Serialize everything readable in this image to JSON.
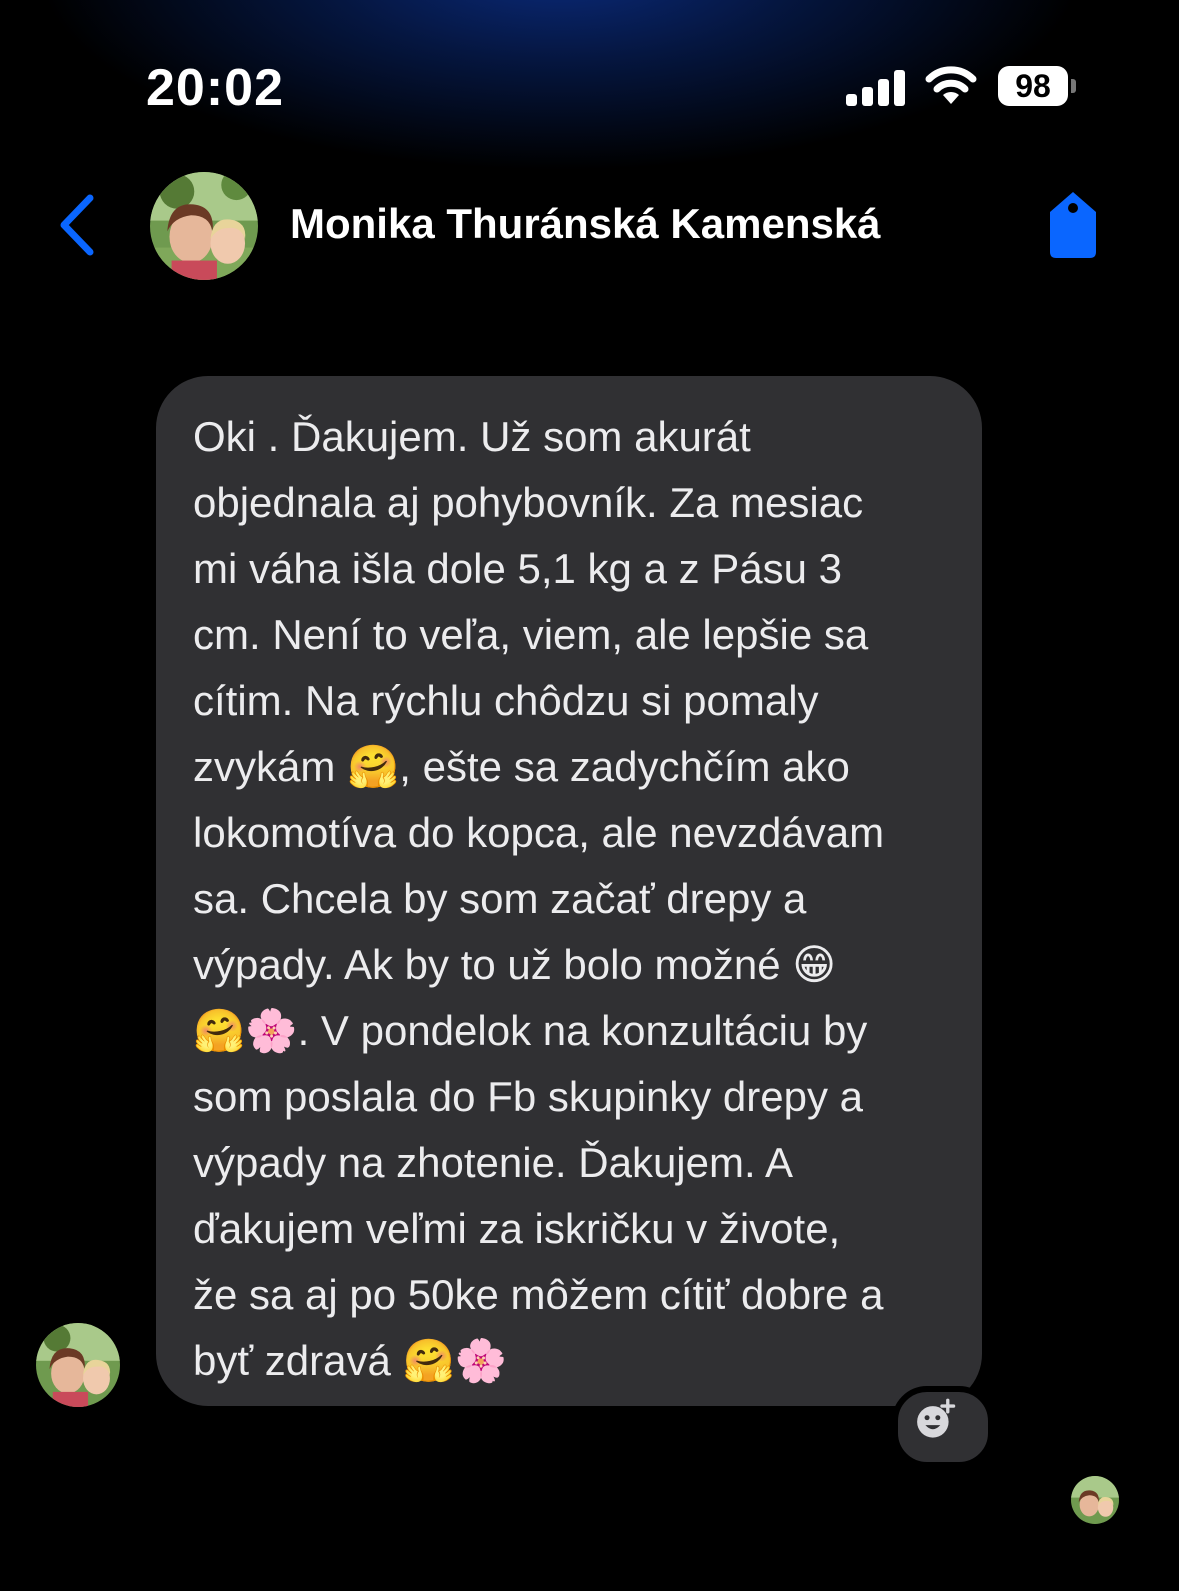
{
  "status_bar": {
    "time": "20:02",
    "battery": "98",
    "signal_icon": "cellular-signal-icon",
    "wifi_icon": "wifi-icon"
  },
  "header": {
    "back_icon": "chevron-left-icon",
    "contact_name": "Monika Thuránská Kamenská",
    "avatar_icon": "contact-avatar",
    "tag_icon": "tag-icon"
  },
  "conversation": {
    "message": "Oki . Ďakujem. Už som akurát\nobjednala aj pohybovník. Za mesiac\nmi váha išla dole 5,1 kg a z Pásu 3\ncm. Není to veľa, viem, ale lepšie sa\ncítim. Na rýchlu chôdzu si pomaly\nzvykám 🤗, ešte sa zadychčím ako\nlokomotíva do kopca, ale nevzdávam\nsa. Chcela by som začať   drepy a\nvýpady. Ak by to už bolo možné 😁\n🤗🌸. V pondelok na konzultáciu by\nsom poslala do Fb skupinky drepy a\nvýpady na zhotenie. Ďakujem. A\nďakujem veľmi za iskričku v živote,\nže sa aj po 50ke môžem cítiť dobre a\nbyť zdravá 🤗🌸",
    "react_icon": "add-reaction-icon"
  },
  "colors": {
    "accent": "#0a66ff",
    "bubble": "#303033",
    "background": "#000000"
  }
}
